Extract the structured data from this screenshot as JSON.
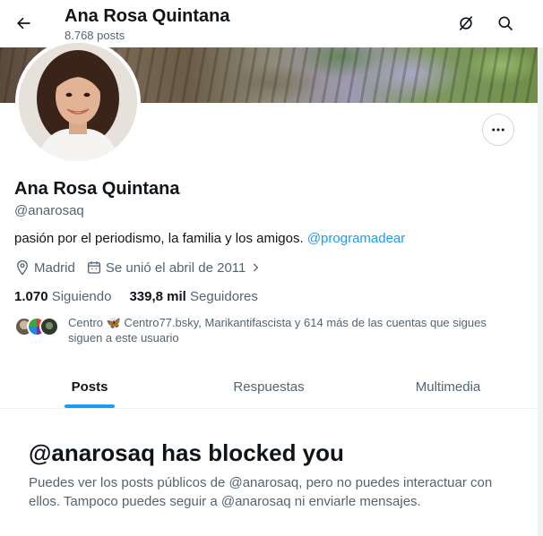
{
  "header": {
    "title": "Ana Rosa Quintana",
    "post_count": "8.768 posts",
    "back_icon": "arrow-left-icon",
    "grok_icon": "grok-icon",
    "search_icon": "search-icon"
  },
  "profile": {
    "name": "Ana Rosa Quintana",
    "handle": "@anarosaq",
    "bio_text": "pasión por el periodismo, la familia y los amigos. ",
    "bio_link": "@programadear",
    "location": "Madrid",
    "joined": "Se unió el abril de 2011",
    "following_count": "1.070",
    "following_label": "Siguiendo",
    "followers_count": "339,8 mil",
    "followers_label": "Seguidores",
    "known_followers": "Centro 🦋 Centro77.bsky, Marikantifascista y 614 más de las cuentas que sigues siguen a este usuario"
  },
  "tabs": [
    {
      "label": "Posts",
      "active": true
    },
    {
      "label": "Respuestas",
      "active": false
    },
    {
      "label": "Multimedia",
      "active": false
    }
  ],
  "blocked": {
    "title": "@anarosaq has blocked you",
    "description": "Puedes ver los posts públicos de @anarosaq, pero no puedes interactuar con ellos. Tampoco puedes seguir a @anarosaq ni enviarle mensajes."
  },
  "colors": {
    "accent": "#1d9bf0",
    "text_primary": "#0f1419",
    "text_secondary": "#536471",
    "border": "#cfd9de"
  }
}
